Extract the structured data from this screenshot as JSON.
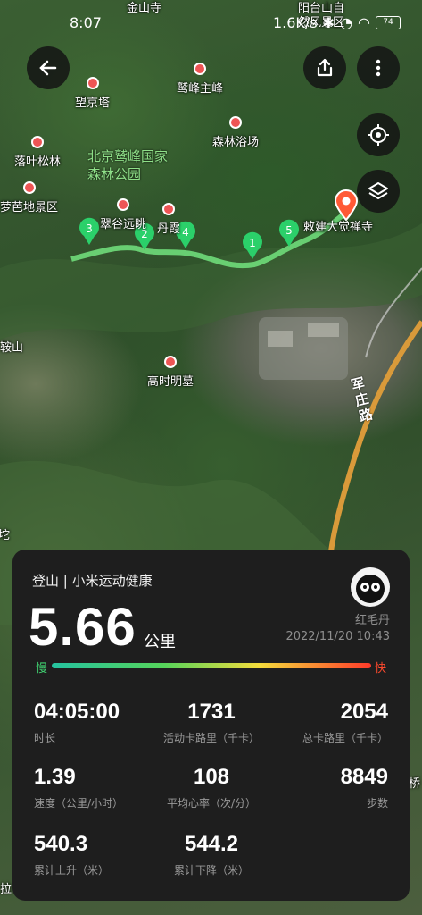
{
  "status": {
    "time": "8:07",
    "speed": "1.6K/s",
    "battery": "74"
  },
  "map": {
    "pois": [
      {
        "name": "金山寺"
      },
      {
        "name": "望京塔"
      },
      {
        "name": "鹫峰主峰"
      },
      {
        "name": "森林浴场"
      },
      {
        "name": "落叶松林"
      },
      {
        "name": "萝芭地景区"
      },
      {
        "name": "翠谷远眺"
      },
      {
        "name": "丹霞"
      },
      {
        "name": "敕建大觉禅寺"
      },
      {
        "name": "高时明墓"
      },
      {
        "name": "阳台山自然风景区"
      },
      {
        "name": "鞍山"
      }
    ],
    "park_label": "北京鹫峰国家森林公园",
    "road_label": "军庄路",
    "markers": [
      "3",
      "2",
      "4",
      "1",
      "5"
    ],
    "left_edge_char": "坨",
    "right_edge_char": "桥",
    "bottom_left_char": "拉"
  },
  "card": {
    "source": "登山 | 小米运动健康",
    "distance": "5.66",
    "distance_unit": "公里",
    "user": "红毛丹",
    "date": "2022/11/20 10:43",
    "slow": "慢",
    "fast": "快",
    "stats": [
      {
        "value": "04:05:00",
        "label": "时长"
      },
      {
        "value": "1731",
        "label": "活动卡路里（千卡）"
      },
      {
        "value": "2054",
        "label": "总卡路里（千卡）"
      },
      {
        "value": "1.39",
        "label": "速度（公里/小时）"
      },
      {
        "value": "108",
        "label": "平均心率（次/分）"
      },
      {
        "value": "8849",
        "label": "步数"
      },
      {
        "value": "540.3",
        "label": "累计上升（米）"
      },
      {
        "value": "544.2",
        "label": "累计下降（米）"
      }
    ]
  },
  "colors": {
    "slow": "#40d070",
    "fast": "#ff4a2e",
    "marker": "#2bd06a",
    "end_pin": "#ff5a36"
  }
}
